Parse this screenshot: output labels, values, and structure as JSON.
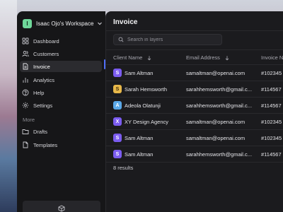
{
  "workspace": {
    "initial": "I",
    "name": "Isaac Ojo's Workspace",
    "avatar_color": "#6fd89a"
  },
  "nav": [
    {
      "label": "Dashboard",
      "icon": "grid-icon"
    },
    {
      "label": "Customers",
      "icon": "users-icon"
    },
    {
      "label": "Invoice",
      "icon": "document-icon",
      "active": true
    },
    {
      "label": "Analytics",
      "icon": "chart-icon"
    },
    {
      "label": "Help",
      "icon": "help-icon"
    },
    {
      "label": "Settings",
      "icon": "gear-icon"
    }
  ],
  "more": {
    "label": "More",
    "items": [
      {
        "label": "Drafts",
        "icon": "folder-icon"
      },
      {
        "label": "Templates",
        "icon": "file-icon"
      }
    ]
  },
  "main": {
    "title": "Invoice",
    "search_placeholder": "Search in layers",
    "columns": [
      "Client Name",
      "Email Address",
      "Invoice Ne"
    ],
    "rows": [
      {
        "initial": "S",
        "name": "Sam Altman",
        "email": "samaltman@openai.com",
        "invoice": "#102345",
        "color": "#7b5cf0"
      },
      {
        "initial": "S",
        "name": "Sarah Hemsworth",
        "email": "sarahhemsworth@gmail.c...",
        "invoice": "#114567",
        "color": "#e8b84a"
      },
      {
        "initial": "A",
        "name": "Adeola Olatunji",
        "email": "sarahhemsworth@gmail.c...",
        "invoice": "#114567",
        "color": "#5aa8e8"
      },
      {
        "initial": "X",
        "name": "XY Design Agency",
        "email": "samaltman@openai.com",
        "invoice": "#102345",
        "color": "#7b5cf0"
      },
      {
        "initial": "S",
        "name": "Sam Altman",
        "email": "samaltman@openai.com",
        "invoice": "#102345",
        "color": "#7b5cf0"
      },
      {
        "initial": "S",
        "name": "Sam Altman",
        "email": "sarahhemsworth@gmail.c...",
        "invoice": "#114567",
        "color": "#7b5cf0"
      }
    ],
    "results": "8 results"
  },
  "colors": {
    "accent": "#4f6ef7",
    "sidebar_bg": "#161618",
    "main_bg": "#1b1b1e"
  }
}
